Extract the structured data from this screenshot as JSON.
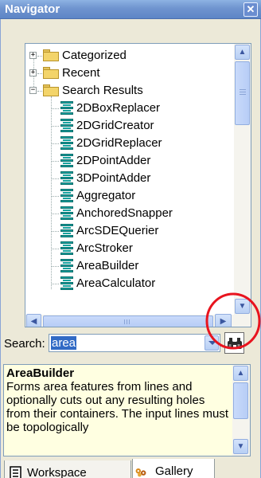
{
  "window": {
    "title": "Navigator",
    "close_symbol": "✕"
  },
  "tree": {
    "categories": [
      {
        "label": "Categorized",
        "expander": "+",
        "icon": "folder-icon"
      },
      {
        "label": "Recent",
        "expander": "+",
        "icon": "folder-icon"
      },
      {
        "label": "Search Results",
        "expander": "−",
        "icon": "folder-icon"
      }
    ],
    "results": [
      "2DBoxReplacer",
      "2DGridCreator",
      "2DGridReplacer",
      "2DPointAdder",
      "3DPointAdder",
      "Aggregator",
      "AnchoredSnapper",
      "ArcSDEQuerier",
      "ArcStroker",
      "AreaBuilder",
      "AreaCalculator"
    ]
  },
  "search": {
    "label": "Search:",
    "value": "area"
  },
  "description": {
    "title": "AreaBuilder",
    "text": "Forms area features from lines and optionally cuts out any resulting holes from their containers.  The input lines must be topologically"
  },
  "tabs": [
    {
      "label": "Workspace",
      "icon": "workspace-icon",
      "active": false
    },
    {
      "label": "Gallery",
      "icon": "gallery-icon",
      "active": true
    }
  ],
  "colors": {
    "title_bar": "#6f94cf",
    "selection": "#316ac5",
    "description_bg": "#ffffe1",
    "highlight_circle": "#e8141e",
    "active_tab_accent": "#e68b2c"
  }
}
